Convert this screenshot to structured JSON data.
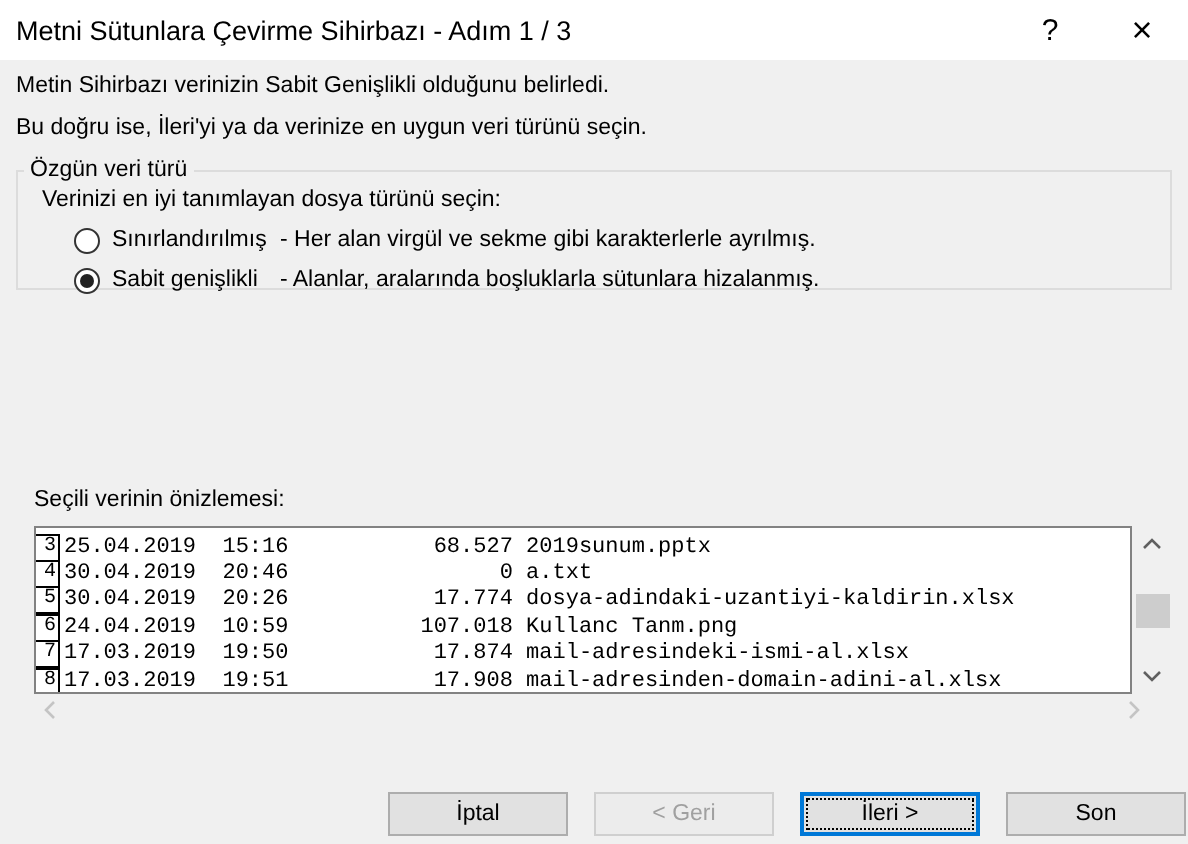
{
  "window": {
    "title": "Metni Sütunlara Çevirme Sihirbazı - Adım 1 / 3",
    "help": "?",
    "close": "×"
  },
  "intro": [
    "Metin Sihirbazı verinizin Sabit Genişlikli olduğunu belirledi.",
    "Bu doğru ise, İleri'yi ya da verinize en uygun veri türünü seçin."
  ],
  "group": {
    "legend": "Özgün veri türü",
    "prompt": "Verinizi en iyi tanımlayan dosya türünü seçin:",
    "options": [
      {
        "label": "Sınırlandırılmış",
        "description": "- Her alan virgül ve sekme gibi karakterlerle ayrılmış.",
        "selected": false
      },
      {
        "label": "Sabit genişlikli",
        "description": "- Alanlar, aralarında boşluklarla sütunlara hizalanmış.",
        "selected": true
      }
    ]
  },
  "preview": {
    "label": "Seçili verinin önizlemesi:",
    "rows": [
      {
        "line": "3",
        "text": "25.04.2019  15:16           68.527 2019sunum.pptx"
      },
      {
        "line": "4",
        "text": "30.04.2019  20:46                0 a.txt"
      },
      {
        "line": "5",
        "text": "30.04.2019  20:26           17.774 dosya-adindaki-uzantiyi-kaldirin.xlsx"
      },
      {
        "line": "6",
        "text": "24.04.2019  10:59          107.018 Kullanc Tanm.png"
      },
      {
        "line": "7",
        "text": "17.03.2019  19:50           17.874 mail-adresindeki-ismi-al.xlsx"
      },
      {
        "line": "8",
        "text": "17.03.2019  19:51           17.908 mail-adresinden-domain-adini-al.xlsx"
      }
    ]
  },
  "buttons": [
    {
      "label": "İptal",
      "disabled": false,
      "focused": false
    },
    {
      "label": "< Geri",
      "disabled": true,
      "focused": false
    },
    {
      "label": "İleri >",
      "disabled": false,
      "focused": true
    },
    {
      "label": "Son",
      "disabled": false,
      "focused": false
    }
  ]
}
